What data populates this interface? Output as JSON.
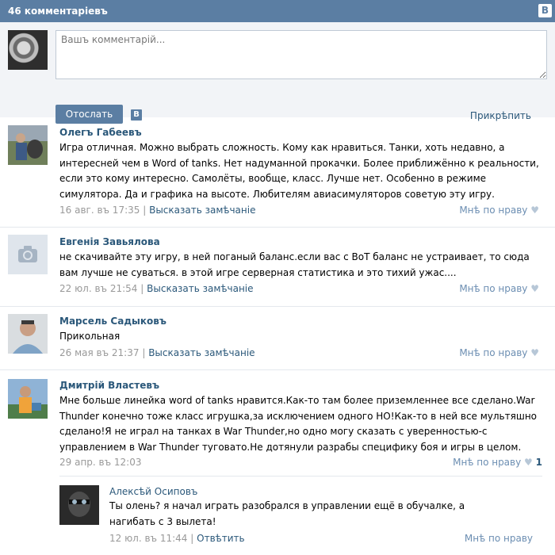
{
  "header": {
    "count_title": "46 комментаріевъ",
    "vk_badge": "B"
  },
  "compose": {
    "placeholder": "Вашъ комментарій...",
    "send_label": "Отослать",
    "vk_share": "B",
    "attach_label": "Прикрѣпить"
  },
  "comments": [
    {
      "author": "Олегъ Габеевъ",
      "text": "Игра отличная. Можно выбрать сложность. Кому как нравиться. Танки, хоть недавно, а интересней чем в Word of tanks. Нет надуманной прокачки. Более приближённо к реальности, если это кому интересно. Самолёты, вообще, класс. Лучше нет. Особенно в режиме симулятора. Да и графика на высоте. Любителям авиасимуляторов советую эту игру.",
      "date": "16 авг. въ 17:35",
      "separator": "|",
      "remark": "Высказать замѣчаніе",
      "like": "Мнѣ по нраву",
      "like_icon": "heart-icon"
    },
    {
      "author": "Евгенія Завьялова",
      "text": "не скачивайте эту игру, в ней поганый баланс.если вас с ВоТ баланс не устраивает, то сюда вам лучше не суваться. в этой игре серверная статистика и это тихий ужас....",
      "date": "22 юл. въ 21:54",
      "separator": "|",
      "remark": "Высказать замѣчаніе",
      "like": "Мнѣ по нраву",
      "like_icon": "heart-icon"
    },
    {
      "author": "Марсель Садыковъ",
      "text": "Прикольная",
      "date": "26 мая въ 21:37",
      "separator": "|",
      "remark": "Высказать замѣчаніе",
      "like": "Мнѣ по нраву",
      "like_icon": "heart-icon"
    },
    {
      "author": "Дмитрій Властевъ",
      "text": "Мне больше линейка word of tanks нравится.Как-то там более приземленнее все сделано.War Thunder конечно тоже класс игрушка,за исключением одного НО!Как-то в ней все мультяшно сделано!Я не играл на танках в War Thunder,но одно могу сказать с уверенностью-с управлением в War Thunder туговато.Не дотянули разрабы специфику боя и игры в целом.",
      "date": "29 апр. въ 12:03",
      "like": "Мнѣ по нраву",
      "like_count": "1",
      "like_icon": "heart-icon"
    }
  ],
  "reply": {
    "author": "Алексѣй Осиповъ",
    "text": "Ты олень? я начал играть разобрался в управлении ещё в обучалке, а нагибать с 3 вылета!",
    "date": "12 юл. въ 11:44",
    "separator": "|",
    "answer": "Отвѣтить",
    "like": "Мнѣ по нраву"
  }
}
